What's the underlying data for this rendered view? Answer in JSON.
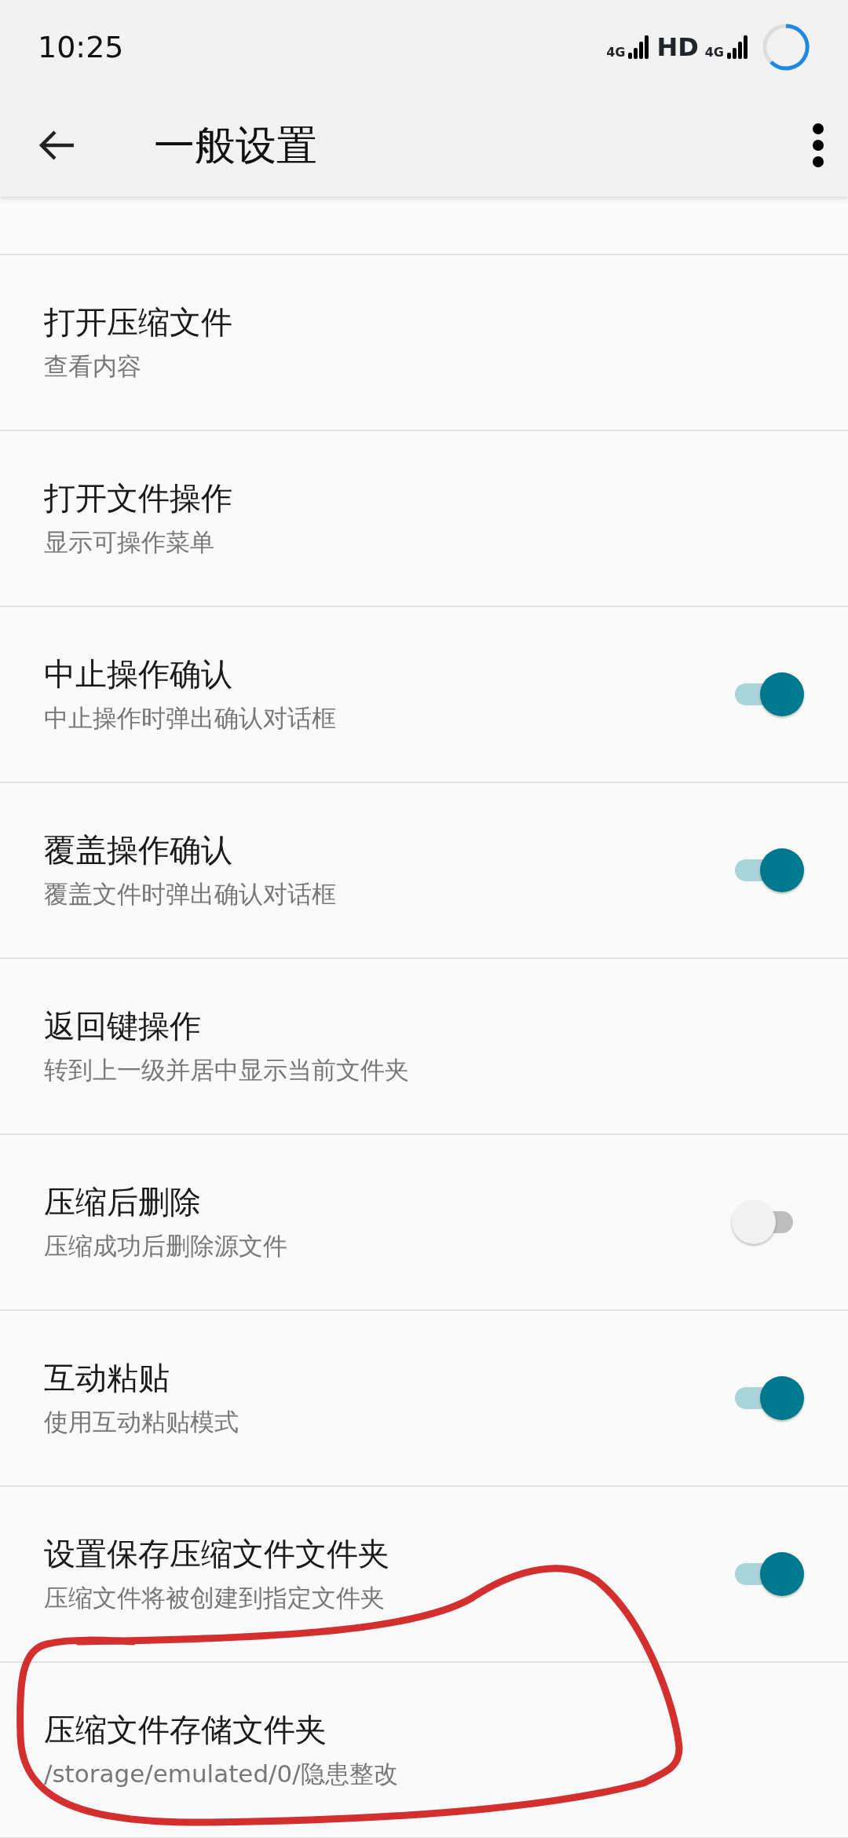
{
  "status_bar": {
    "time": "10:25",
    "network_1": "4G",
    "hd": "HD",
    "network_2": "4G"
  },
  "app_bar": {
    "title": "一般设置"
  },
  "settings": [
    {
      "title": "打开压缩文件",
      "subtitle": "查看内容",
      "kind": "text"
    },
    {
      "title": "打开文件操作",
      "subtitle": "显示可操作菜单",
      "kind": "text"
    },
    {
      "title": "中止操作确认",
      "subtitle": "中止操作时弹出确认对话框",
      "kind": "switch",
      "on": true
    },
    {
      "title": "覆盖操作确认",
      "subtitle": "覆盖文件时弹出确认对话框",
      "kind": "switch",
      "on": true
    },
    {
      "title": "返回键操作",
      "subtitle": "转到上一级并居中显示当前文件夹",
      "kind": "text"
    },
    {
      "title": "压缩后删除",
      "subtitle": "压缩成功后删除源文件",
      "kind": "switch",
      "on": false
    },
    {
      "title": "互动粘贴",
      "subtitle": "使用互动粘贴模式",
      "kind": "switch",
      "on": true
    },
    {
      "title": "设置保存压缩文件文件夹",
      "subtitle": "压缩文件将被创建到指定文件夹",
      "kind": "switch",
      "on": true
    },
    {
      "title": "压缩文件存储文件夹",
      "subtitle": "/storage/emulated/0/隐患整改",
      "kind": "text"
    }
  ],
  "annotation": {
    "kind": "circle"
  }
}
